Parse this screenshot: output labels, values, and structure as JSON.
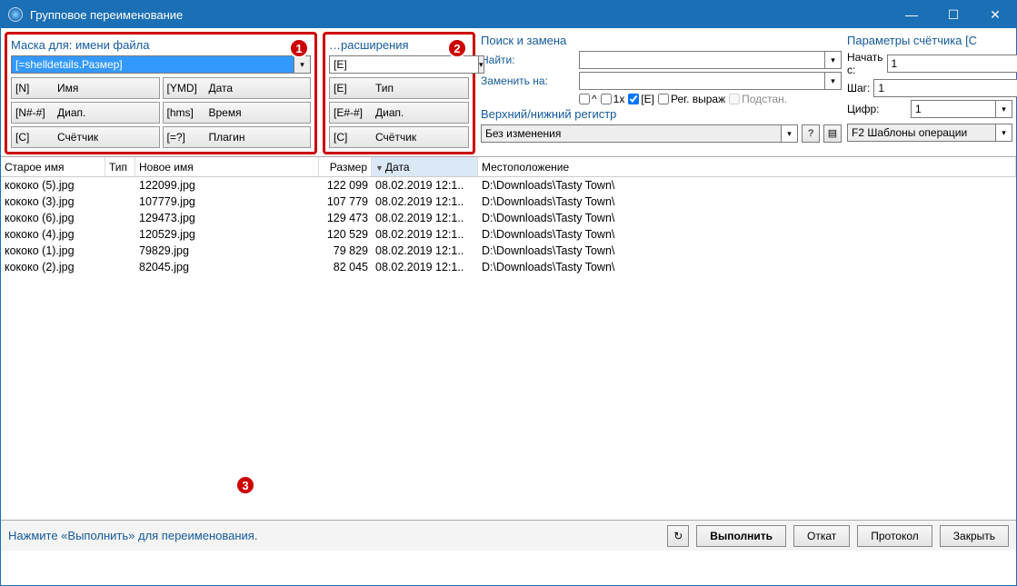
{
  "window": {
    "title": "Групповое переименование"
  },
  "name_mask": {
    "header": "Маска для: имени файла",
    "value": "[=shelldetails.Размер]",
    "buttons": [
      {
        "code": "[N]",
        "label": "Имя"
      },
      {
        "code": "[YMD]",
        "label": "Дата"
      },
      {
        "code": "[N#-#]",
        "label": "Диап."
      },
      {
        "code": "[hms]",
        "label": "Время"
      },
      {
        "code": "[C]",
        "label": "Счётчик"
      },
      {
        "code": "[=?]",
        "label": "Плагин"
      }
    ]
  },
  "ext_mask": {
    "header": "…расширения",
    "value": "[E]",
    "buttons": [
      {
        "code": "[E]",
        "label": "Тип"
      },
      {
        "code": "[E#-#]",
        "label": "Диап."
      },
      {
        "code": "[C]",
        "label": "Счётчик"
      }
    ]
  },
  "find_replace": {
    "header": "Поиск и замена",
    "find_label": "Найти:",
    "replace_label": "Заменить на:",
    "find_value": "",
    "replace_value": "",
    "chk_caret": "^",
    "chk_1x": "1x",
    "chk_E": "[E]",
    "chk_regex": "Рег. выраж",
    "chk_subst": "Подстан.",
    "case_header": "Верхний/нижний регистр",
    "case_value": "Без изменения"
  },
  "counter": {
    "header": "Параметры счётчика [C",
    "start_label": "Начать с:",
    "start_value": "1",
    "step_label": "Шаг:",
    "step_value": "1",
    "digits_label": "Цифр:",
    "digits_value": "1",
    "template_label": "F2 Шаблоны операции"
  },
  "list": {
    "columns": {
      "old": "Старое имя",
      "type": "Тип",
      "new": "Новое имя",
      "size": "Размер",
      "date": "Дата",
      "loc": "Местоположение"
    },
    "rows": [
      {
        "old": "кококо (5).jpg",
        "type": "",
        "new": "122099.jpg",
        "size": "122 099",
        "date": "08.02.2019 12:1..",
        "loc": "D:\\Downloads\\Tasty Town\\"
      },
      {
        "old": "кококо (3).jpg",
        "type": "",
        "new": "107779.jpg",
        "size": "107 779",
        "date": "08.02.2019 12:1..",
        "loc": "D:\\Downloads\\Tasty Town\\"
      },
      {
        "old": "кококо (6).jpg",
        "type": "",
        "new": "129473.jpg",
        "size": "129 473",
        "date": "08.02.2019 12:1..",
        "loc": "D:\\Downloads\\Tasty Town\\"
      },
      {
        "old": "кококо (4).jpg",
        "type": "",
        "new": "120529.jpg",
        "size": "120 529",
        "date": "08.02.2019 12:1..",
        "loc": "D:\\Downloads\\Tasty Town\\"
      },
      {
        "old": "кококо (1).jpg",
        "type": "",
        "new": "79829.jpg",
        "size": "79 829",
        "date": "08.02.2019 12:1..",
        "loc": "D:\\Downloads\\Tasty Town\\"
      },
      {
        "old": "кококо (2).jpg",
        "type": "",
        "new": "82045.jpg",
        "size": "82 045",
        "date": "08.02.2019 12:1..",
        "loc": "D:\\Downloads\\Tasty Town\\"
      }
    ]
  },
  "footer": {
    "hint": "Нажмите «Выполнить» для переименования.",
    "execute": "Выполнить",
    "undo": "Откат",
    "protocol": "Протокол",
    "close": "Закрыть"
  },
  "badges": {
    "b1": "1",
    "b2": "2",
    "b3": "3"
  }
}
